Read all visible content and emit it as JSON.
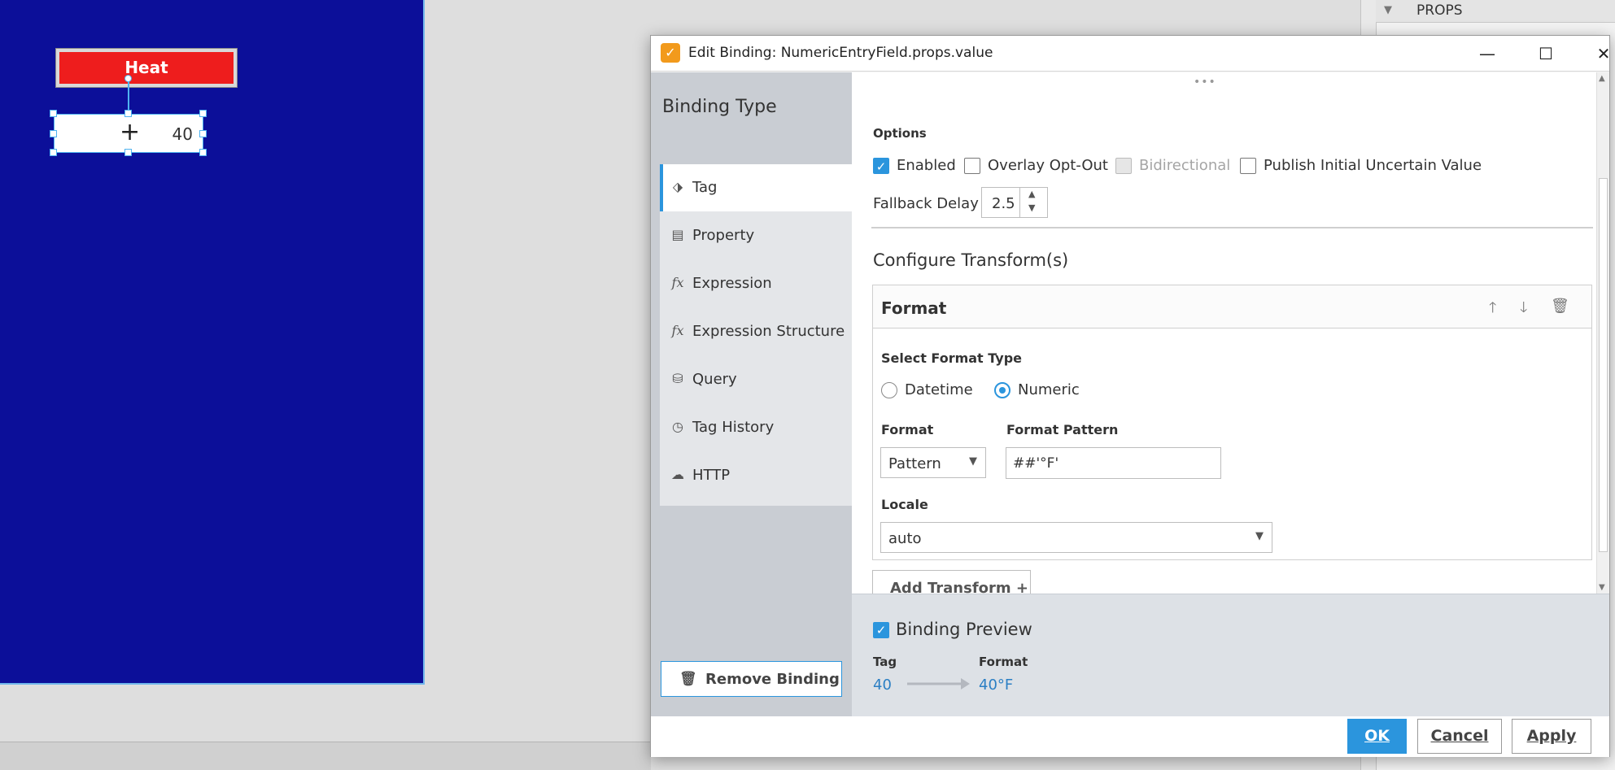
{
  "designer": {
    "heat_button_label": "Heat",
    "numeric_value": "40",
    "props_panel_label": "PROPS"
  },
  "dialog": {
    "title": "Edit Binding: NumericEntryField.props.value",
    "binding_type_title": "Binding Type",
    "binding_types": [
      {
        "label": "Tag",
        "icon": "tag-icon"
      },
      {
        "label": "Property",
        "icon": "property-icon"
      },
      {
        "label": "Expression",
        "icon": "fx-icon"
      },
      {
        "label": "Expression Structure",
        "icon": "fx-icon"
      },
      {
        "label": "Query",
        "icon": "database-icon"
      },
      {
        "label": "Tag History",
        "icon": "clock-icon"
      },
      {
        "label": "HTTP",
        "icon": "cloud-icon"
      }
    ],
    "active_binding_type": "Tag",
    "remove_binding_label": "Remove Binding",
    "options": {
      "label": "Options",
      "enabled_label": "Enabled",
      "enabled_checked": true,
      "overlay_label": "Overlay Opt-Out",
      "overlay_checked": false,
      "bidirectional_label": "Bidirectional",
      "bidirectional_disabled": true,
      "publish_label": "Publish Initial Uncertain Value",
      "publish_checked": false,
      "fallback_label": "Fallback Delay",
      "fallback_value": "2.5"
    },
    "transforms": {
      "title": "Configure Transform(s)",
      "card_title": "Format",
      "select_format_type_label": "Select Format Type",
      "format_types": [
        "Datetime",
        "Numeric"
      ],
      "selected_format_type": "Numeric",
      "format_label": "Format",
      "format_value": "Pattern",
      "pattern_label": "Format Pattern",
      "pattern_value": "##'°F'",
      "locale_label": "Locale",
      "locale_value": "auto",
      "add_transform_label": "Add Transform +"
    },
    "preview": {
      "title": "Binding Preview",
      "checked": true,
      "tag_label": "Tag",
      "tag_value": "40",
      "format_label": "Format",
      "format_value": "40°F"
    },
    "footer": {
      "ok_label": "OK",
      "cancel_label": "Cancel",
      "apply_label": "Apply"
    }
  },
  "colors": {
    "canvas": "#0c0f99",
    "heat_button": "#ee1d1d",
    "accent": "#2b95dd"
  }
}
